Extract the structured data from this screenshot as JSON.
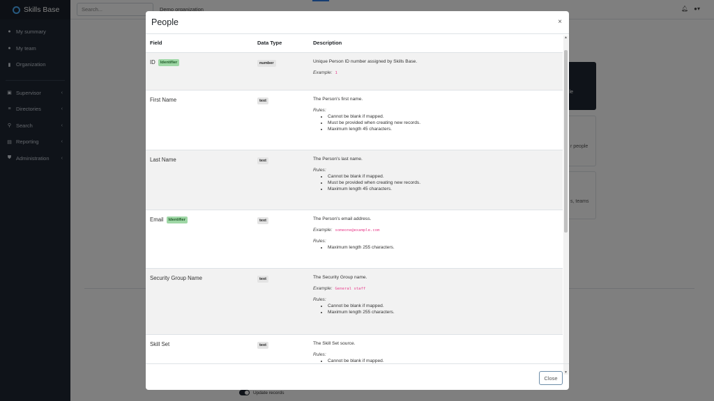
{
  "app": {
    "brand": "Skills Base"
  },
  "sidebar": {
    "items": [
      {
        "label": "My summary",
        "icon": "user-circle-icon",
        "glyph": "●"
      },
      {
        "label": "My team",
        "icon": "team-icon",
        "glyph": "●"
      },
      {
        "label": "Organization",
        "icon": "building-icon",
        "glyph": "▮"
      }
    ],
    "groups": [
      {
        "label": "Supervisor",
        "icon": "calendar-icon",
        "glyph": "▣"
      },
      {
        "label": "Directories",
        "icon": "list-icon",
        "glyph": "≡"
      },
      {
        "label": "Search",
        "icon": "search-icon",
        "glyph": "⚲"
      },
      {
        "label": "Reporting",
        "icon": "chart-icon",
        "glyph": "▤"
      },
      {
        "label": "Administration",
        "icon": "shield-icon",
        "glyph": "⛊"
      }
    ]
  },
  "topbar": {
    "search_placeholder": "Search...",
    "organization": "Demo organization"
  },
  "background": {
    "card_dark_text": "le",
    "card1_text": "r people",
    "card2_text": "s, teams",
    "toggle_label": "Update records"
  },
  "modal": {
    "title": "People",
    "close_x": "×",
    "columns": {
      "field": "Field",
      "type": "Data Type",
      "description": "Description"
    },
    "rows": [
      {
        "field": "ID",
        "identifier": "Identifier",
        "type": "number",
        "description": "Unique Person ID number assigned by Skills Base.",
        "example_label": "Example:",
        "example": "1",
        "rules_label": "",
        "rules": []
      },
      {
        "field": "First Name",
        "identifier": "",
        "type": "text",
        "description": "The Person's first name.",
        "example_label": "",
        "example": "",
        "rules_label": "Rules:",
        "rules": [
          "Cannot be blank if mapped.",
          "Must be provided when creating new records.",
          "Maximum length 45 characters."
        ]
      },
      {
        "field": "Last Name",
        "identifier": "",
        "type": "text",
        "description": "The Person's last name.",
        "example_label": "",
        "example": "",
        "rules_label": "Rules:",
        "rules": [
          "Cannot be blank if mapped.",
          "Must be provided when creating new records.",
          "Maximum length 45 characters."
        ]
      },
      {
        "field": "Email",
        "identifier": "Identifier",
        "type": "text",
        "description": "The Person's email address.",
        "example_label": "Example:",
        "example": "someone@example.com",
        "rules_label": "Rules:",
        "rules": [
          "Maximum length 255 characters."
        ]
      },
      {
        "field": "Security Group Name",
        "identifier": "",
        "type": "text",
        "description": "The Security Group name.",
        "example_label": "Example:",
        "example": "General staff",
        "rules_label": "Rules:",
        "rules": [
          "Cannot be blank if mapped.",
          "Maximum length 255 characters."
        ]
      },
      {
        "field": "Skill Set",
        "identifier": "",
        "type": "text",
        "description": "The Skill Set source.",
        "example_label": "",
        "example": "",
        "rules_label": "Rules:",
        "rules": [
          "Cannot be blank if mapped."
        ]
      }
    ],
    "close_button": "Close"
  }
}
